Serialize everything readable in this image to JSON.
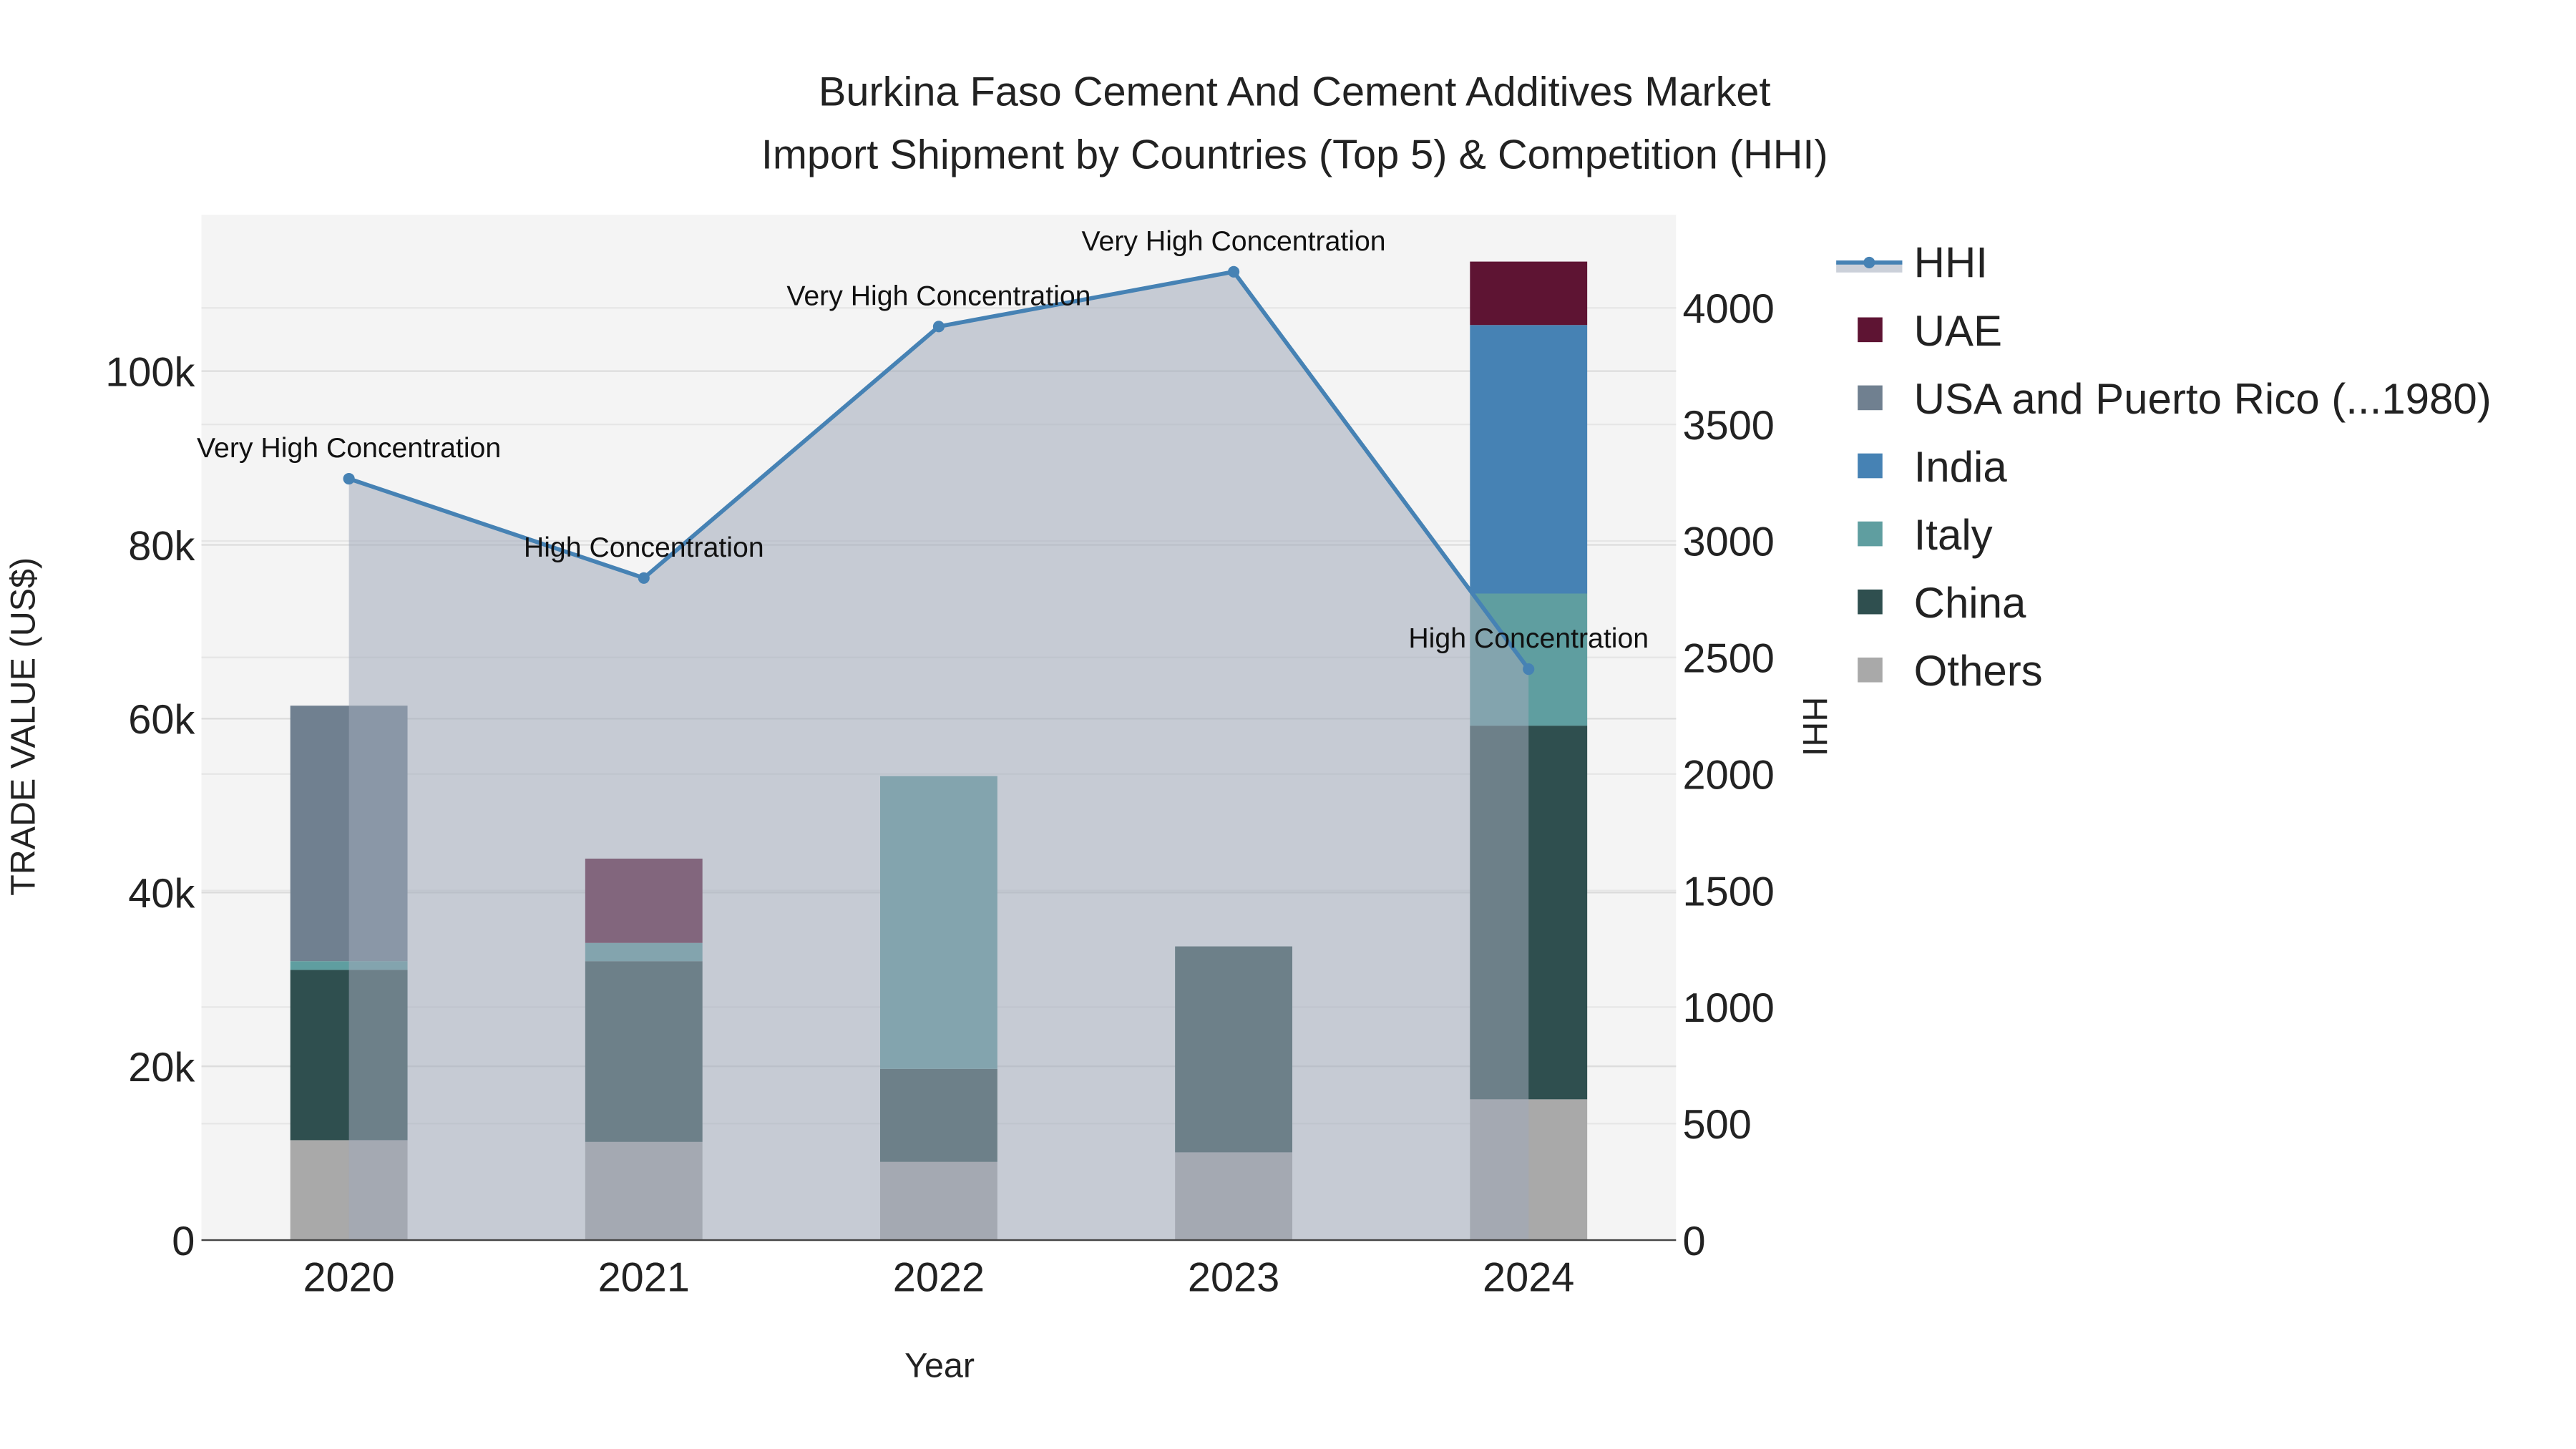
{
  "chart_data": {
    "type": "bar",
    "title": "Burkina Faso Cement And Cement Additives Market",
    "subtitle": "Import Shipment by Countries (Top 5) & Competition (HHI)",
    "xlabel": "Year",
    "ylabel": "TRADE VALUE (US$)",
    "y2label": "HHI",
    "categories": [
      "2020",
      "2021",
      "2022",
      "2023",
      "2024"
    ],
    "ylim": [
      0,
      118000
    ],
    "y2lim": [
      0,
      4400
    ],
    "yticks": [
      0,
      20000,
      40000,
      60000,
      80000,
      100000
    ],
    "ytick_labels": [
      "0",
      "20k",
      "40k",
      "60k",
      "80k",
      "100k"
    ],
    "y2ticks": [
      0,
      500,
      1000,
      1500,
      2000,
      2500,
      3000,
      3500,
      4000
    ],
    "grid": true,
    "legend_position": "right",
    "series": [
      {
        "name": "Others",
        "color": "#a9a9a9",
        "values": [
          11500,
          11300,
          9000,
          10100,
          16200
        ]
      },
      {
        "name": "China",
        "color": "#2f4f4f",
        "values": [
          19600,
          20800,
          10700,
          23700,
          43000
        ]
      },
      {
        "name": "Italy",
        "color": "#5f9ea0",
        "values": [
          1000,
          2100,
          33700,
          0,
          15200
        ]
      },
      {
        "name": "India",
        "color": "#4682b4",
        "values": [
          0,
          0,
          0,
          0,
          30900
        ]
      },
      {
        "name": "USA and Puerto Rico (...1980)",
        "color": "#708090",
        "values": [
          29400,
          0,
          0,
          0,
          0
        ]
      },
      {
        "name": "UAE",
        "color": "#5e1433",
        "values": [
          0,
          9700,
          0,
          0,
          7300
        ]
      }
    ],
    "hhi": {
      "name": "HHI",
      "color": "#4682b4",
      "values": [
        3267,
        2841,
        3920,
        4155,
        2450
      ],
      "annotations": [
        "Very High Concentration",
        "High Concentration",
        "Very High Concentration",
        "Very High Concentration",
        "High Concentration"
      ]
    },
    "legend_order": [
      "HHI",
      "UAE",
      "USA and Puerto Rico (...1980)",
      "India",
      "Italy",
      "China",
      "Others"
    ]
  }
}
